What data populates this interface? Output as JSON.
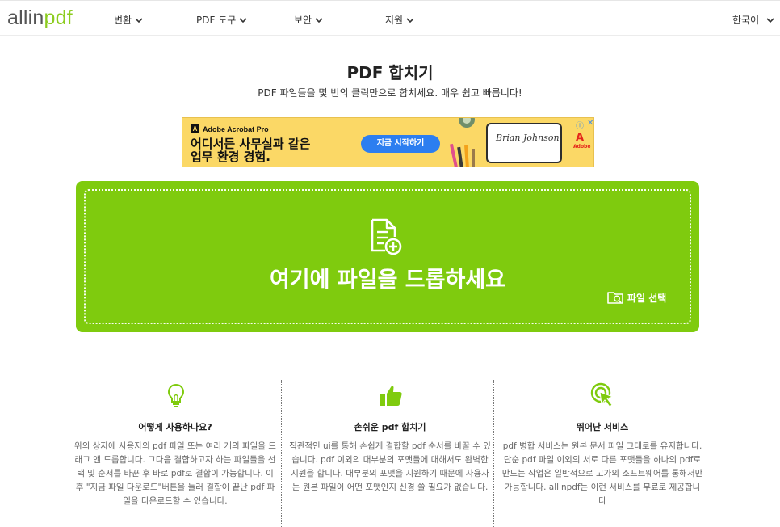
{
  "header": {
    "logo": {
      "part1": "allin",
      "part2": "pdf"
    },
    "nav": [
      {
        "label": "변환"
      },
      {
        "label": "PDF 도구"
      },
      {
        "label": "보안"
      },
      {
        "label": "지원"
      }
    ],
    "language": "한국어"
  },
  "hero": {
    "title": "PDF 합치기",
    "subtitle": "PDF 파일들을 몇 번의 클릭만으로 합치세요. 매우 쉽고 빠릅니다!"
  },
  "ad": {
    "brand": "Adobe Acrobat Pro",
    "headline_line1": "어디서든 사무실과 같은",
    "headline_line2": "업무 환경 경험.",
    "cta": "지금 시작하기",
    "signature": "Brian Johnson",
    "adobe_logo": "Adobe"
  },
  "dropzone": {
    "text": "여기에 파일을 드롭하세요",
    "select_label": "파일 선택"
  },
  "features": [
    {
      "icon": "lightbulb-icon",
      "title": "어떻게 사용하나요?",
      "desc": "위의 상자에 사용자의 pdf 파일 또는 여러 개의 파일을 드래그 앤 드롭합니다. 그다음 결합하고자 하는 파일들을 선택 및 순서를 바꾼 후 바로 pdf로 결합이 가능합니다. 이후 \"지금 파일 다운로드\"버튼을 눌러 결합이 끝난 pdf 파일을 다운로드할 수 있습니다."
    },
    {
      "icon": "thumbs-up-icon",
      "title": "손쉬운 pdf 합치기",
      "desc": "직관적인 ui를 통해 손쉽게 결합할 pdf 순서를 바꿀 수 있습니다. pdf 이외의 대부분의 포맷들에 대해서도 완벽한 지원을 합니다. 대부분의 포맷을 지원하기 때문에 사용자는 원본 파일이 어떤 포맷인지 신경 쓸 필요가 없습니다."
    },
    {
      "icon": "cursor-click-icon",
      "title": "뛰어난 서비스",
      "desc": "pdf 병합 서비스는 원본 문서 파일 그대로를 유지합니다. 단순 pdf 파일 이외의 서로 다른 포맷들을 하나의 pdf로 만드는 작업은 일반적으로 고가의 소프트웨어를 통해서만 가능합니다. allinpdf는 이런 서비스를 무료로 제공합니다"
    }
  ],
  "colors": {
    "accent": "#7fcb0e",
    "logo_accent": "#8ccc1f",
    "ad_bg": "#fbd866",
    "ad_cta": "#2c7ef0"
  }
}
